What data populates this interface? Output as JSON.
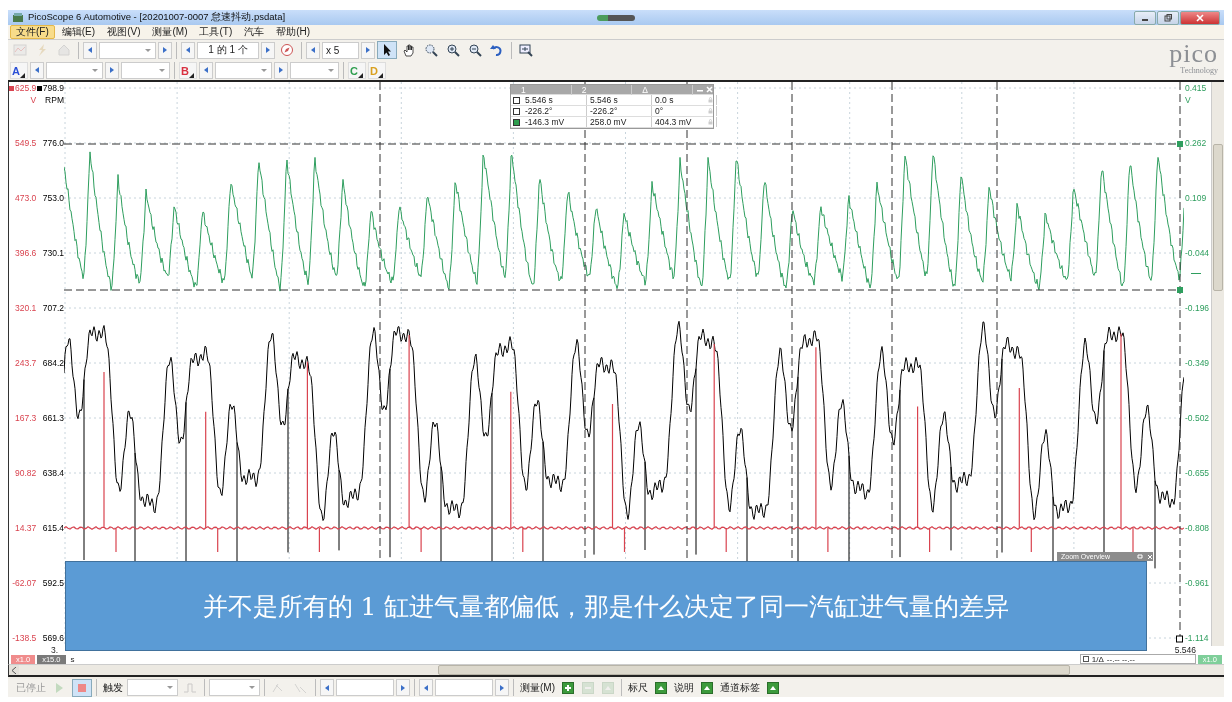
{
  "window": {
    "title": "PicoScope 6 Automotive - [20201007-0007  怠速抖动.psdata]"
  },
  "menu": [
    {
      "label": "文件(F)",
      "selected": true
    },
    {
      "label": "编辑(E)",
      "selected": false
    },
    {
      "label": "视图(V)",
      "selected": false
    },
    {
      "label": "测量(M)",
      "selected": false
    },
    {
      "label": "工具(T)",
      "selected": false
    },
    {
      "label": "汽车",
      "selected": false
    },
    {
      "label": "帮助(H)",
      "selected": false
    }
  ],
  "toolbar": {
    "page_counter": "1 的 1 个",
    "zoom_factor": "x 5"
  },
  "logo": {
    "name": "pico",
    "tagline": "Technology"
  },
  "channels": [
    {
      "label": "A",
      "color": "#2a4fd6"
    },
    {
      "label": "B",
      "color": "#d93040"
    },
    {
      "label": "C",
      "color": "#2e9e4e"
    },
    {
      "label": "D",
      "color": "#d9a020"
    }
  ],
  "cursor_table": {
    "columns": [
      "1",
      "2",
      "Δ"
    ],
    "rows": [
      {
        "color": "#ffffff",
        "cells": [
          "5.546 s",
          "5.546 s",
          "0.0 s"
        ]
      },
      {
        "color": "#ffffff",
        "cells": [
          "-226.2°",
          "-226.2°",
          "0°"
        ]
      },
      {
        "color": "#2e9e4e",
        "cells": [
          "-146.3 mV",
          "258.0 mV",
          "404.3 mV"
        ]
      }
    ]
  },
  "axes_left": [
    {
      "unit": "V",
      "color": "#d9434f",
      "ticks": [
        "625.9",
        "549.5",
        "473.0",
        "396.6",
        "320.1",
        "243.7",
        "167.3",
        "90.82",
        "14.37",
        "-62.07",
        "-138.5"
      ]
    },
    {
      "unit": "RPM",
      "color": "#000000",
      "ticks": [
        "798.9",
        "776.0",
        "753.0",
        "730.1",
        "707.2",
        "684.2",
        "661.3",
        "638.4",
        "615.4",
        "592.5",
        "569.6"
      ]
    }
  ],
  "axis_right": {
    "unit": "V",
    "color": "#2e9e5e",
    "ticks": [
      "0.415",
      "0.262",
      "0.109",
      "-0.044",
      "-0.196",
      "-0.349",
      "-0.502",
      "-0.655",
      "-0.808",
      "-0.961",
      "-1.114"
    ]
  },
  "time_axis": {
    "start": "3.",
    "end": "5.546",
    "unit": "s"
  },
  "scale_badges": [
    {
      "label": "x1.0",
      "color": "#f08c8c"
    },
    {
      "label": "x15.0",
      "color": "#7a7a7a"
    }
  ],
  "ruler_readout": {
    "label": "1/Δ",
    "value": "--.-- --.--"
  },
  "right_badge": {
    "label": "x1.0",
    "color": "#7fcf9a"
  },
  "zoom_overview": {
    "title": "Zoom Overview"
  },
  "caption": "并不是所有的 1 缸进气量都偏低，那是什么决定了同一汽缸进气量的差异",
  "status_bar": {
    "state": "已停止",
    "trigger_label": "触发",
    "measure_label": "测量(M)",
    "toggles": [
      {
        "label": "标尺",
        "on": true
      },
      {
        "label": "说明",
        "on": true
      },
      {
        "label": "通道标签",
        "on": true
      }
    ]
  }
}
